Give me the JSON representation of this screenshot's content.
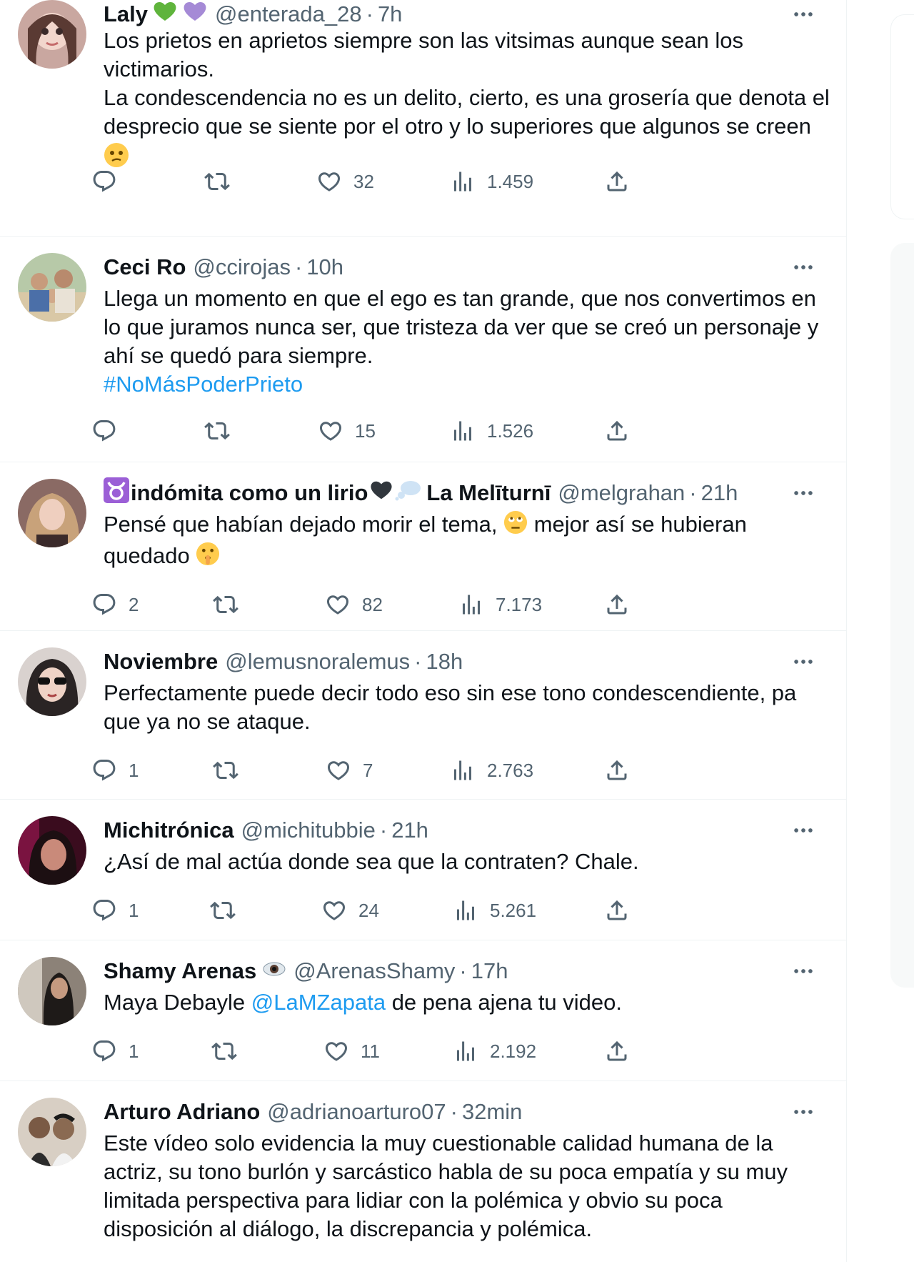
{
  "tweets": [
    {
      "name": "Laly",
      "handle": "@enterada_28",
      "time": "7h",
      "body": [
        "Los prietos en aprietos siempre son las vitsimas aunque sean los victimarios.",
        "La condescendencia no es un delito, cierto, es una grosería que denota el desprecio que se siente por el otro y lo superiores que algunos se creen"
      ],
      "stats": {
        "replies": "",
        "reposts": "",
        "likes": "32",
        "views": "1.459"
      }
    },
    {
      "name": "Ceci Ro",
      "handle": "@ccirojas",
      "time": "10h",
      "body": [
        "Llega un momento en que el ego es tan grande, que nos convertimos en lo que juramos nunca ser, que tristeza da ver que se creó un personaje y ahí se quedó para siempre."
      ],
      "hashtag": "#NoMásPoderPrieto",
      "stats": {
        "replies": "",
        "reposts": "",
        "likes": "15",
        "views": "1.526"
      }
    },
    {
      "name_a": "indómita como un lirio",
      "name_b": "La Melīturnī",
      "handle": "@melgrahan",
      "time": "21h",
      "body_a": "Pensé que habían dejado morir el tema,",
      "body_b": "mejor así se hubieran",
      "body_c": "quedado",
      "stats": {
        "replies": "2",
        "reposts": "",
        "likes": "82",
        "views": "7.173"
      }
    },
    {
      "name": "Noviembre",
      "handle": "@lemusnoralemus",
      "time": "18h",
      "body": [
        "Perfectamente puede decir todo eso sin ese tono condescendiente, pa que ya no se ataque."
      ],
      "stats": {
        "replies": "1",
        "reposts": "",
        "likes": "7",
        "views": "2.763"
      }
    },
    {
      "name": "Michitrónica",
      "handle": "@michitubbie",
      "time": "21h",
      "body": [
        "¿Así de mal actúa donde sea que la contraten? Chale."
      ],
      "stats": {
        "replies": "1",
        "reposts": "",
        "likes": "24",
        "views": "5.261"
      }
    },
    {
      "name": "Shamy Arenas",
      "handle": "@ArenasShamy",
      "time": "17h",
      "body_pre": "Maya Debayle ",
      "mention": "@LaMZapata",
      "body_post": " de pena ajena tu video.",
      "stats": {
        "replies": "1",
        "reposts": "",
        "likes": "11",
        "views": "2.192"
      }
    },
    {
      "name": "Arturo Adriano",
      "handle": "@adrianoarturo07",
      "time": "32min",
      "body": [
        "Este vídeo solo evidencia la muy cuestionable calidad humana de la actriz, su tono burlón y sarcástico habla de su poca empatía y su muy limitada perspectiva para lidiar con la polémica y obvio su poca disposición al diálogo, la discrepancia y polémica."
      ],
      "stats": {
        "replies": "",
        "reposts": "",
        "likes": "",
        "views": ""
      }
    }
  ],
  "colors": {
    "text": "#0f1419",
    "muted": "#536471",
    "link": "#1d9bf0",
    "border": "#eff3f4"
  },
  "icons": [
    "reply-icon",
    "repost-icon",
    "like-icon",
    "views-icon",
    "share-icon",
    "more-icon"
  ]
}
